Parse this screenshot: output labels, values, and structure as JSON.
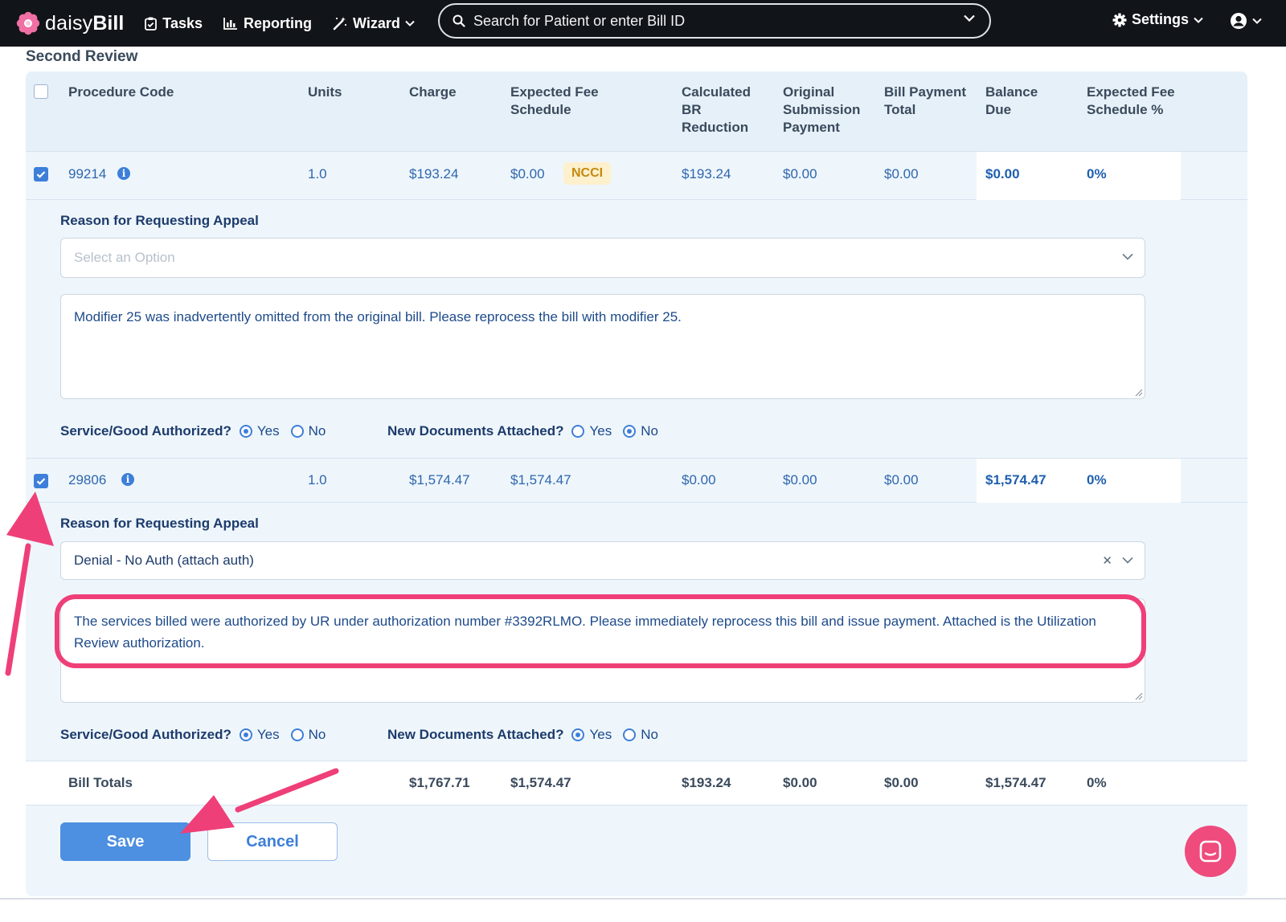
{
  "nav": {
    "brand_light": "daisy",
    "brand_bold": "Bill",
    "tasks": "Tasks",
    "reporting": "Reporting",
    "wizard": "Wizard",
    "search_placeholder": "Search for Patient or enter Bill ID",
    "settings": "Settings"
  },
  "section": {
    "title": "Second Review"
  },
  "table": {
    "headers": {
      "procedure_code": "Procedure Code",
      "units": "Units",
      "charge": "Charge",
      "expected_fee_schedule": "Expected Fee Schedule",
      "calculated_br_reduction": "Calculated BR Reduction",
      "original_submission_payment": "Original Submission Payment",
      "bill_payment_total": "Bill Payment Total",
      "balance_due": "Balance Due",
      "expected_fee_schedule_pct": "Expected Fee Schedule %"
    },
    "rows": [
      {
        "checked": true,
        "code": "99214",
        "units": "1.0",
        "charge": "$193.24",
        "expected_fee": "$0.00",
        "badge": "NCCI",
        "br_reduction": "$193.24",
        "original_payment": "$0.00",
        "payment_total": "$0.00",
        "balance_due": "$0.00",
        "pct": "0%",
        "appeal": {
          "label": "Reason for Requesting Appeal",
          "select_placeholder": "Select an Option",
          "select_value": "",
          "text": "Modifier 25 was inadvertently omitted from the original bill. Please reprocess the bill with modifier 25.",
          "authorized_q": "Service/Good Authorized?",
          "authorized": "Yes",
          "docs_q": "New Documents Attached?",
          "docs": "No"
        }
      },
      {
        "checked": true,
        "code": "29806",
        "units": "1.0",
        "charge": "$1,574.47",
        "expected_fee": "$1,574.47",
        "badge": "",
        "br_reduction": "$0.00",
        "original_payment": "$0.00",
        "payment_total": "$0.00",
        "balance_due": "$1,574.47",
        "pct": "0%",
        "appeal": {
          "label": "Reason for Requesting Appeal",
          "select_placeholder": "",
          "select_value": "Denial - No Auth (attach auth)",
          "text": "The services billed were authorized by UR under authorization number #3392RLMO. Please immediately reprocess this bill and issue payment. Attached is the Utilization Review authorization.",
          "authorized_q": "Service/Good Authorized?",
          "authorized": "Yes",
          "docs_q": "New Documents Attached?",
          "docs": "Yes"
        }
      }
    ],
    "totals": {
      "label": "Bill Totals",
      "charge": "$1,767.71",
      "expected_fee": "$1,574.47",
      "br_reduction": "$193.24",
      "original_payment": "$0.00",
      "payment_total": "$0.00",
      "balance_due": "$1,574.47",
      "pct": "0%"
    }
  },
  "radio_labels": {
    "yes": "Yes",
    "no": "No"
  },
  "buttons": {
    "save": "Save",
    "cancel": "Cancel"
  },
  "colors": {
    "navbar": "#111418",
    "accent": "#3d7fd9",
    "annotation": "#ef3f78",
    "badge_bg": "#fdf0cc",
    "badge_text": "#c48a10"
  }
}
